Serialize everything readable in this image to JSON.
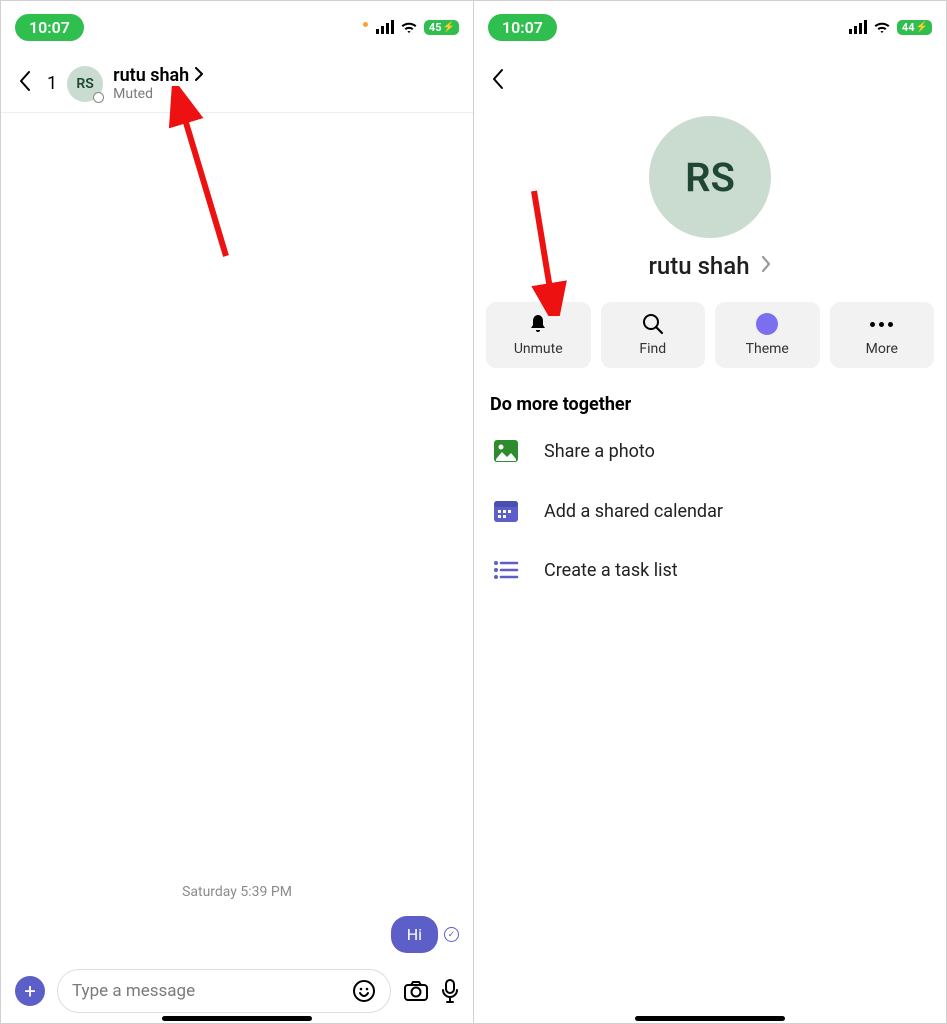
{
  "left": {
    "status": {
      "time": "10:07",
      "battery": "45"
    },
    "header": {
      "count": "1",
      "avatar_initials": "RS",
      "name": "rutu shah",
      "subtitle": "Muted"
    },
    "chat": {
      "timestamp": "Saturday 5:39 PM",
      "message": "Hi"
    },
    "composer": {
      "placeholder": "Type a message"
    }
  },
  "right": {
    "status": {
      "time": "10:07",
      "battery": "44"
    },
    "profile": {
      "avatar_initials": "RS",
      "name": "rutu shah"
    },
    "actions": {
      "unmute": "Unmute",
      "find": "Find",
      "theme": "Theme",
      "more": "More"
    },
    "section_title": "Do more together",
    "items": {
      "photo": "Share a photo",
      "calendar": "Add a shared calendar",
      "tasks": "Create a task list"
    }
  }
}
